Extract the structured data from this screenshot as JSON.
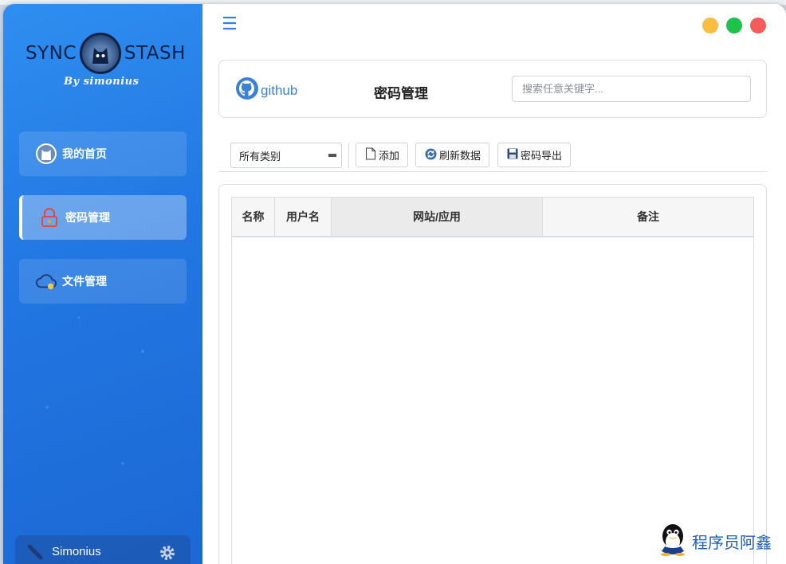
{
  "sidebar": {
    "logo": {
      "left_word": "SYNC",
      "right_word": "STASH",
      "tagline": "By simonius"
    },
    "items": [
      {
        "label": "我的首页",
        "icon": "github-icon",
        "active": false
      },
      {
        "label": "密码管理",
        "icon": "lock-icon",
        "active": true
      },
      {
        "label": "文件管理",
        "icon": "cloud-icon",
        "active": false
      }
    ],
    "user": {
      "name": "Simonius"
    }
  },
  "window_controls": {
    "minimize_color": "#fbbd40",
    "maximize_color": "#1ec14a",
    "close_color": "#f45b5b"
  },
  "header": {
    "brand": "github",
    "title": "密码管理",
    "search_placeholder": "搜索任意关键字..."
  },
  "toolbar": {
    "category_select": "所有类别",
    "add_label": "添加",
    "refresh_label": "刷新数据",
    "export_label": "密码导出"
  },
  "table": {
    "columns": [
      "名称",
      "用户名",
      "网站/应用",
      "备注"
    ],
    "rows": []
  },
  "watermark": {
    "text": "程序员阿鑫"
  },
  "colors": {
    "accent": "#2f7ee6",
    "sidebar": "#2277e2"
  }
}
